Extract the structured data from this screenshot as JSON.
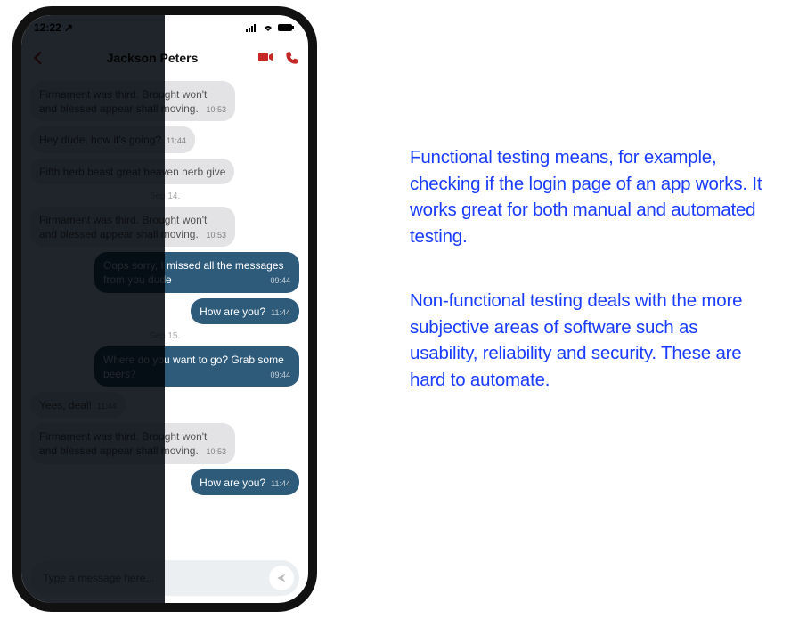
{
  "status": {
    "time": "12:22",
    "indicators": "📶 📡 🔋"
  },
  "nav": {
    "contact": "Jackson Peters"
  },
  "messages": [
    {
      "dir": "in",
      "text": "Firmament was third. Brought won't and blessed appear shall moving.",
      "time": "10:53"
    },
    {
      "dir": "in",
      "text": "Hey dude, how it's going?",
      "time": "11:44"
    },
    {
      "dir": "in",
      "text": "Fifth herb beast great heaven herb give",
      "time": ""
    },
    {
      "sep": "Sep 14."
    },
    {
      "dir": "in",
      "text": "Firmament was third. Brought won't and blessed appear shall moving.",
      "time": "10:53"
    },
    {
      "dir": "out",
      "text": "Oops sorry, I missed all the messages from you dude",
      "time": "09:44"
    },
    {
      "dir": "out",
      "text": "How are you?",
      "time": "11:44"
    },
    {
      "sep": "Sep 15."
    },
    {
      "dir": "out",
      "text": "Where do you want to go? Grab some beers?",
      "time": "09:44"
    },
    {
      "dir": "in",
      "text": "Yees, deal!",
      "time": "11:44"
    },
    {
      "dir": "in",
      "text": "Firmament was third. Brought won't and blessed appear shall moving.",
      "time": "10:53"
    },
    {
      "dir": "out",
      "text": "How are you?",
      "time": "11:44"
    }
  ],
  "input": {
    "placeholder": "Type a message here..."
  },
  "side": {
    "p1": "Functional testing means, for example, checking if the login page of an app works. It works great for both manual and automated testing.",
    "p2": "Non-functional testing deals with the more subjective areas of software such as usability, reliability and security. These are hard to automate."
  }
}
